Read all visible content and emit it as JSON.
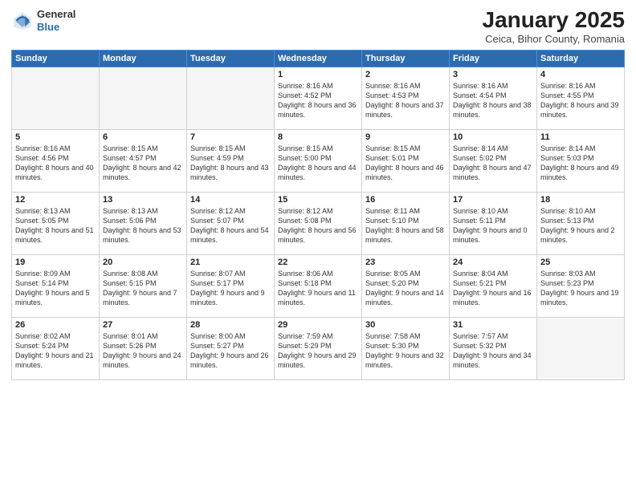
{
  "header": {
    "logo_line1": "General",
    "logo_line2": "Blue",
    "title": "January 2025",
    "subtitle": "Ceica, Bihor County, Romania"
  },
  "weekdays": [
    "Sunday",
    "Monday",
    "Tuesday",
    "Wednesday",
    "Thursday",
    "Friday",
    "Saturday"
  ],
  "weeks": [
    [
      {
        "day": "",
        "info": ""
      },
      {
        "day": "",
        "info": ""
      },
      {
        "day": "",
        "info": ""
      },
      {
        "day": "1",
        "info": "Sunrise: 8:16 AM\nSunset: 4:52 PM\nDaylight: 8 hours and 36 minutes."
      },
      {
        "day": "2",
        "info": "Sunrise: 8:16 AM\nSunset: 4:53 PM\nDaylight: 8 hours and 37 minutes."
      },
      {
        "day": "3",
        "info": "Sunrise: 8:16 AM\nSunset: 4:54 PM\nDaylight: 8 hours and 38 minutes."
      },
      {
        "day": "4",
        "info": "Sunrise: 8:16 AM\nSunset: 4:55 PM\nDaylight: 8 hours and 39 minutes."
      }
    ],
    [
      {
        "day": "5",
        "info": "Sunrise: 8:16 AM\nSunset: 4:56 PM\nDaylight: 8 hours and 40 minutes."
      },
      {
        "day": "6",
        "info": "Sunrise: 8:15 AM\nSunset: 4:57 PM\nDaylight: 8 hours and 42 minutes."
      },
      {
        "day": "7",
        "info": "Sunrise: 8:15 AM\nSunset: 4:59 PM\nDaylight: 8 hours and 43 minutes."
      },
      {
        "day": "8",
        "info": "Sunrise: 8:15 AM\nSunset: 5:00 PM\nDaylight: 8 hours and 44 minutes."
      },
      {
        "day": "9",
        "info": "Sunrise: 8:15 AM\nSunset: 5:01 PM\nDaylight: 8 hours and 46 minutes."
      },
      {
        "day": "10",
        "info": "Sunrise: 8:14 AM\nSunset: 5:02 PM\nDaylight: 8 hours and 47 minutes."
      },
      {
        "day": "11",
        "info": "Sunrise: 8:14 AM\nSunset: 5:03 PM\nDaylight: 8 hours and 49 minutes."
      }
    ],
    [
      {
        "day": "12",
        "info": "Sunrise: 8:13 AM\nSunset: 5:05 PM\nDaylight: 8 hours and 51 minutes."
      },
      {
        "day": "13",
        "info": "Sunrise: 8:13 AM\nSunset: 5:06 PM\nDaylight: 8 hours and 53 minutes."
      },
      {
        "day": "14",
        "info": "Sunrise: 8:12 AM\nSunset: 5:07 PM\nDaylight: 8 hours and 54 minutes."
      },
      {
        "day": "15",
        "info": "Sunrise: 8:12 AM\nSunset: 5:08 PM\nDaylight: 8 hours and 56 minutes."
      },
      {
        "day": "16",
        "info": "Sunrise: 8:11 AM\nSunset: 5:10 PM\nDaylight: 8 hours and 58 minutes."
      },
      {
        "day": "17",
        "info": "Sunrise: 8:10 AM\nSunset: 5:11 PM\nDaylight: 9 hours and 0 minutes."
      },
      {
        "day": "18",
        "info": "Sunrise: 8:10 AM\nSunset: 5:13 PM\nDaylight: 9 hours and 2 minutes."
      }
    ],
    [
      {
        "day": "19",
        "info": "Sunrise: 8:09 AM\nSunset: 5:14 PM\nDaylight: 9 hours and 5 minutes."
      },
      {
        "day": "20",
        "info": "Sunrise: 8:08 AM\nSunset: 5:15 PM\nDaylight: 9 hours and 7 minutes."
      },
      {
        "day": "21",
        "info": "Sunrise: 8:07 AM\nSunset: 5:17 PM\nDaylight: 9 hours and 9 minutes."
      },
      {
        "day": "22",
        "info": "Sunrise: 8:06 AM\nSunset: 5:18 PM\nDaylight: 9 hours and 11 minutes."
      },
      {
        "day": "23",
        "info": "Sunrise: 8:05 AM\nSunset: 5:20 PM\nDaylight: 9 hours and 14 minutes."
      },
      {
        "day": "24",
        "info": "Sunrise: 8:04 AM\nSunset: 5:21 PM\nDaylight: 9 hours and 16 minutes."
      },
      {
        "day": "25",
        "info": "Sunrise: 8:03 AM\nSunset: 5:23 PM\nDaylight: 9 hours and 19 minutes."
      }
    ],
    [
      {
        "day": "26",
        "info": "Sunrise: 8:02 AM\nSunset: 5:24 PM\nDaylight: 9 hours and 21 minutes."
      },
      {
        "day": "27",
        "info": "Sunrise: 8:01 AM\nSunset: 5:26 PM\nDaylight: 9 hours and 24 minutes."
      },
      {
        "day": "28",
        "info": "Sunrise: 8:00 AM\nSunset: 5:27 PM\nDaylight: 9 hours and 26 minutes."
      },
      {
        "day": "29",
        "info": "Sunrise: 7:59 AM\nSunset: 5:29 PM\nDaylight: 9 hours and 29 minutes."
      },
      {
        "day": "30",
        "info": "Sunrise: 7:58 AM\nSunset: 5:30 PM\nDaylight: 9 hours and 32 minutes."
      },
      {
        "day": "31",
        "info": "Sunrise: 7:57 AM\nSunset: 5:32 PM\nDaylight: 9 hours and 34 minutes."
      },
      {
        "day": "",
        "info": ""
      }
    ]
  ]
}
